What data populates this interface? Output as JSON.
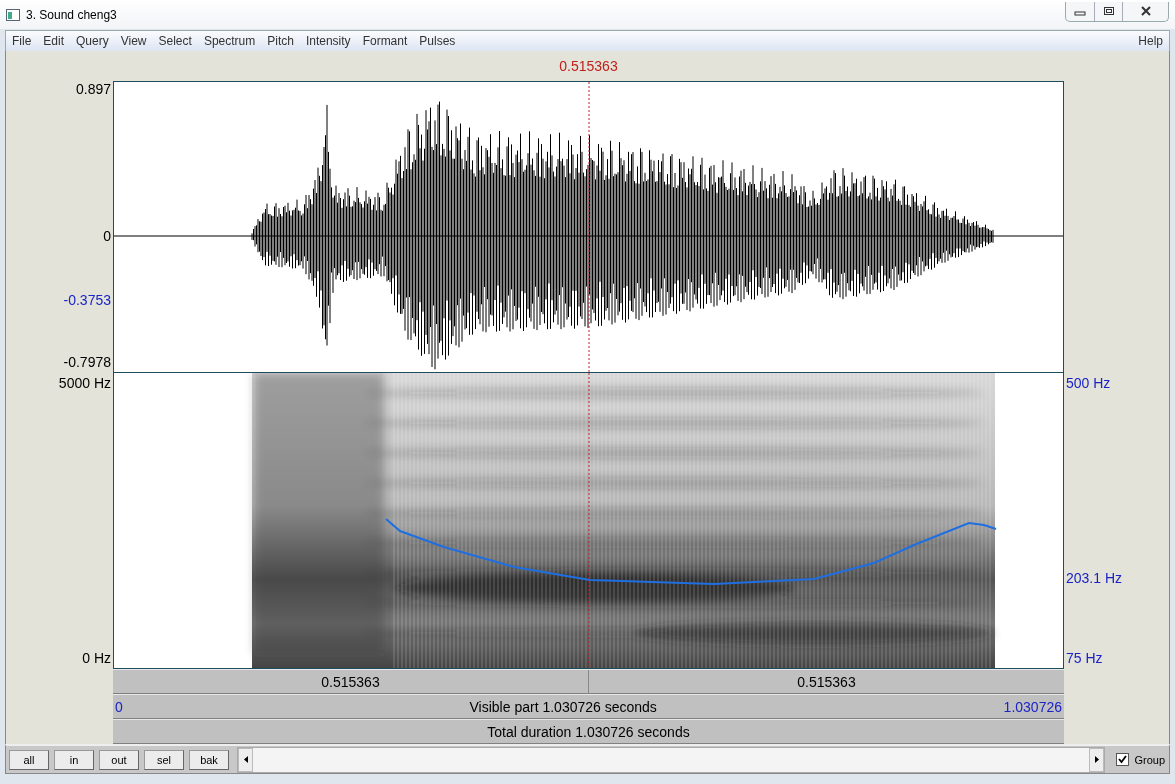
{
  "window": {
    "title": "3. Sound cheng3"
  },
  "menu": {
    "items": [
      "File",
      "Edit",
      "Query",
      "View",
      "Select",
      "Spectrum",
      "Pitch",
      "Intensity",
      "Formant",
      "Pulses"
    ],
    "help": "Help"
  },
  "cursor": {
    "time": "0.515363"
  },
  "waveform": {
    "max": "0.897",
    "zero": "0",
    "cursor_value": "-0.3753",
    "min": "-0.7978"
  },
  "spectrogram": {
    "left_top": "5000 Hz",
    "left_bottom": "0 Hz",
    "right_top": "500 Hz",
    "right_cursor": "203.1 Hz",
    "right_bottom": "75 Hz"
  },
  "time_rows": {
    "left_of_cursor": "0.515363",
    "right_of_cursor": "0.515363",
    "visible_start": "0",
    "visible_label": "Visible part 1.030726 seconds",
    "visible_end": "1.030726",
    "total_label": "Total duration 1.030726 seconds"
  },
  "buttons": [
    "all",
    "in",
    "out",
    "sel",
    "bak"
  ],
  "group": {
    "label": "Group",
    "checked": true
  }
}
